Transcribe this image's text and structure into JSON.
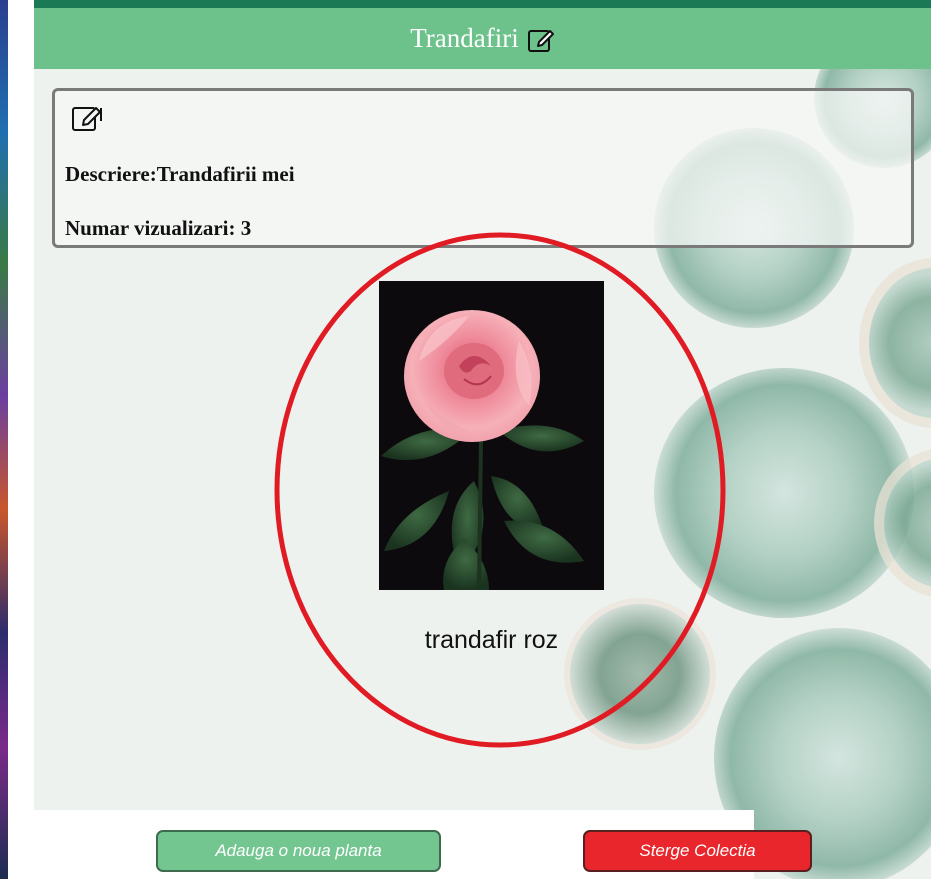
{
  "collection": {
    "title": "Trandafiri",
    "description_line": "Descriere:Trandafirii mei",
    "views_line": "Numar vizualizari: 3"
  },
  "plants": [
    {
      "name": "trandafir roz",
      "image": "pink-rose-photo"
    }
  ],
  "buttons": {
    "add_plant": "Adauga o noua planta",
    "delete_collection": "Sterge Colectia"
  },
  "icons": {
    "title_edit": "edit-icon",
    "details_edit": "edit-icon"
  },
  "colors": {
    "header": "#6cc28a",
    "add_button": "#74c691",
    "delete_button": "#e8262c",
    "highlight": "#e01b24"
  }
}
